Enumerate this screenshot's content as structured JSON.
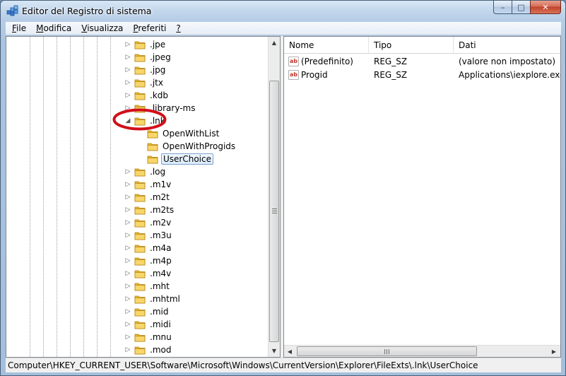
{
  "window": {
    "title": "Editor del Registro di sistema",
    "icon": "registry-editor-icon"
  },
  "caption_buttons": {
    "minimize": "–",
    "maximize": "□",
    "close": "✕"
  },
  "menu": {
    "items": [
      {
        "mnemonic": "F",
        "rest": "ile"
      },
      {
        "mnemonic": "M",
        "rest": "odifica"
      },
      {
        "mnemonic": "V",
        "rest": "isualizza"
      },
      {
        "mnemonic": "P",
        "rest": "referiti"
      },
      {
        "mnemonic": "?",
        "rest": ""
      }
    ]
  },
  "tree": {
    "items": [
      {
        "label": ".jpe",
        "level": 0,
        "expander": "▷"
      },
      {
        "label": ".jpeg",
        "level": 0,
        "expander": "▷"
      },
      {
        "label": ".jpg",
        "level": 0,
        "expander": "▷"
      },
      {
        "label": ".jtx",
        "level": 0,
        "expander": "▷"
      },
      {
        "label": ".kdb",
        "level": 0,
        "expander": "▷"
      },
      {
        "label": ".library-ms",
        "level": 0,
        "expander": "▷"
      },
      {
        "label": ".lnk",
        "level": 0,
        "expander": "◢"
      },
      {
        "label": "OpenWithList",
        "level": 1,
        "expander": ""
      },
      {
        "label": "OpenWithProgids",
        "level": 1,
        "expander": ""
      },
      {
        "label": "UserChoice",
        "level": 1,
        "expander": "",
        "selected": true
      },
      {
        "label": ".log",
        "level": 0,
        "expander": "▷"
      },
      {
        "label": ".m1v",
        "level": 0,
        "expander": "▷"
      },
      {
        "label": ".m2t",
        "level": 0,
        "expander": "▷"
      },
      {
        "label": ".m2ts",
        "level": 0,
        "expander": "▷"
      },
      {
        "label": ".m2v",
        "level": 0,
        "expander": "▷"
      },
      {
        "label": ".m3u",
        "level": 0,
        "expander": "▷"
      },
      {
        "label": ".m4a",
        "level": 0,
        "expander": "▷"
      },
      {
        "label": ".m4p",
        "level": 0,
        "expander": "▷"
      },
      {
        "label": ".m4v",
        "level": 0,
        "expander": "▷"
      },
      {
        "label": ".mht",
        "level": 0,
        "expander": "▷"
      },
      {
        "label": ".mhtml",
        "level": 0,
        "expander": "▷"
      },
      {
        "label": ".mid",
        "level": 0,
        "expander": "▷"
      },
      {
        "label": ".midi",
        "level": 0,
        "expander": "▷"
      },
      {
        "label": ".mnu",
        "level": 0,
        "expander": "▷"
      },
      {
        "label": ".mod",
        "level": 0,
        "expander": "▷"
      }
    ]
  },
  "list": {
    "columns": [
      "Nome",
      "Tipo",
      "Dati"
    ],
    "rows": [
      {
        "name": "(Predefinito)",
        "type": "REG_SZ",
        "data": "(valore non impostato)",
        "icon": "string-value-icon"
      },
      {
        "name": "Progid",
        "type": "REG_SZ",
        "data": "Applications\\iexplore.exe",
        "icon": "string-value-icon"
      }
    ]
  },
  "statusbar": {
    "path": "Computer\\HKEY_CURRENT_USER\\Software\\Microsoft\\Windows\\CurrentVersion\\Explorer\\FileExts\\.lnk\\UserChoice"
  },
  "annotation_color": "#d0101a",
  "icon_text": "ab"
}
